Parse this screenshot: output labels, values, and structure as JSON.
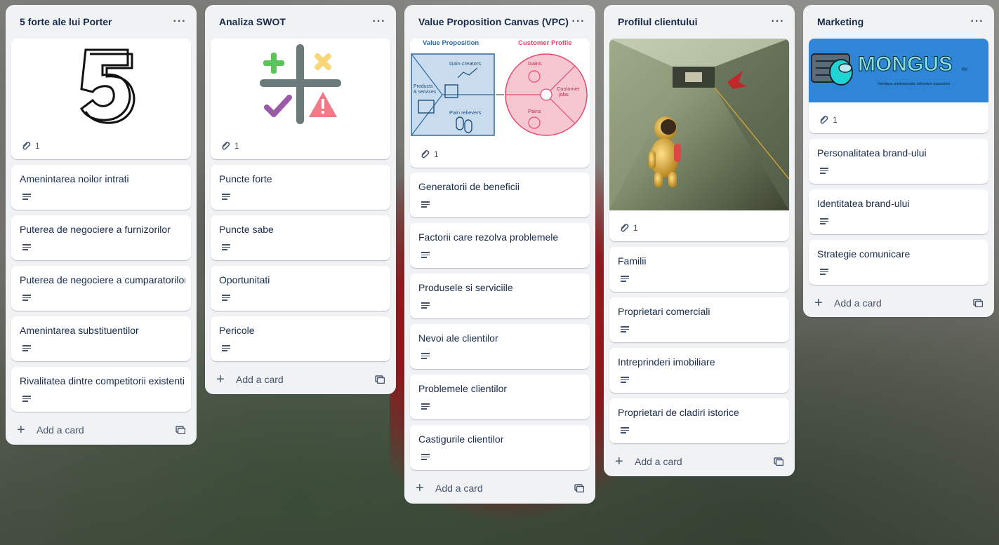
{
  "lists": [
    {
      "title": "5 forte ale lui Porter",
      "cover_attachments": "1",
      "cards": [
        {
          "title": "Amenintarea noilor intrati"
        },
        {
          "title": "Puterea de negociere a furnizorilor"
        },
        {
          "title": "Puterea de negociere a cumparatorilor"
        },
        {
          "title": "Amenintarea substituentilor"
        },
        {
          "title": "Rivalitatea dintre competitorii existenti"
        }
      ],
      "add_card": "Add a card"
    },
    {
      "title": "Analiza SWOT",
      "cover_attachments": "1",
      "cards": [
        {
          "title": "Puncte forte"
        },
        {
          "title": "Puncte sabe"
        },
        {
          "title": "Oportunitati"
        },
        {
          "title": "Pericole"
        }
      ],
      "add_card": "Add a card"
    },
    {
      "title": "Value Proposition Canvas (VPC)",
      "cover_attachments": "1",
      "cover_image": {
        "left_title": "Value Proposition",
        "right_title": "Customer Profile",
        "gain_creators": "Gain creators",
        "products_services_1": "Products",
        "products_services_2": "& services",
        "pain_relievers": "Pain relievers",
        "gains": "Gains",
        "customer_jobs_1": "Customer",
        "customer_jobs_2": "jobs",
        "pains": "Pains"
      },
      "cards": [
        {
          "title": "Generatorii de beneficii"
        },
        {
          "title": "Factorii care rezolva problemele"
        },
        {
          "title": "Produsele si serviciile"
        },
        {
          "title": "Nevoi ale clientilor"
        },
        {
          "title": "Problemele clientilor"
        },
        {
          "title": "Castigurile clientilor"
        }
      ],
      "add_card": "Add a card"
    },
    {
      "title": "Profilul clientului",
      "cover_attachments": "1",
      "cards": [
        {
          "title": "Familii"
        },
        {
          "title": "Proprietari comerciali"
        },
        {
          "title": "Intreprinderi imobiliare"
        },
        {
          "title": "Proprietari de cladiri istorice"
        }
      ],
      "add_card": "Add a card"
    },
    {
      "title": "Marketing",
      "cover_attachments": "1",
      "cover_image": {
        "brand": "MONGUS",
        "brand_suffix": "RV",
        "tagline": "Ventilare profesionala, eliminam impostorii"
      },
      "cards": [
        {
          "title": "Personalitatea brand-ului"
        },
        {
          "title": "Identitatea brand-ului"
        },
        {
          "title": "Strategie comunicare"
        }
      ],
      "add_card": "Add a card"
    }
  ],
  "list_menu_glyph": "···",
  "colors": {
    "list_bg": "#f1f2f4",
    "card_bg": "#ffffff",
    "text": "#172b4d",
    "muted": "#44546f",
    "vpc_blue": "#2d6aa0",
    "vpc_pink": "#e8496b",
    "mongus_blue": "#2f86d6"
  }
}
